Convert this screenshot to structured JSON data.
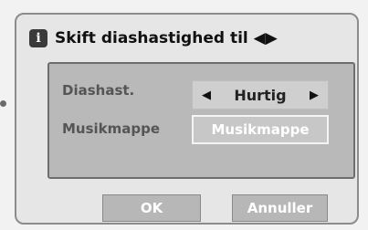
{
  "dialog": {
    "title": "Skift diashastighed til ◀▶",
    "info_icon": "i"
  },
  "fields": {
    "speed_label": "Diashast.",
    "speed_value": "Hurtig",
    "music_label": "Musikmappe",
    "music_value": "Musikmappe"
  },
  "buttons": {
    "ok": "OK",
    "cancel": "Annuller"
  },
  "icons": {
    "left": "◀",
    "right": "▶"
  },
  "colors": {
    "panel": "#b9b9b9",
    "button": "#b7b7b7"
  }
}
